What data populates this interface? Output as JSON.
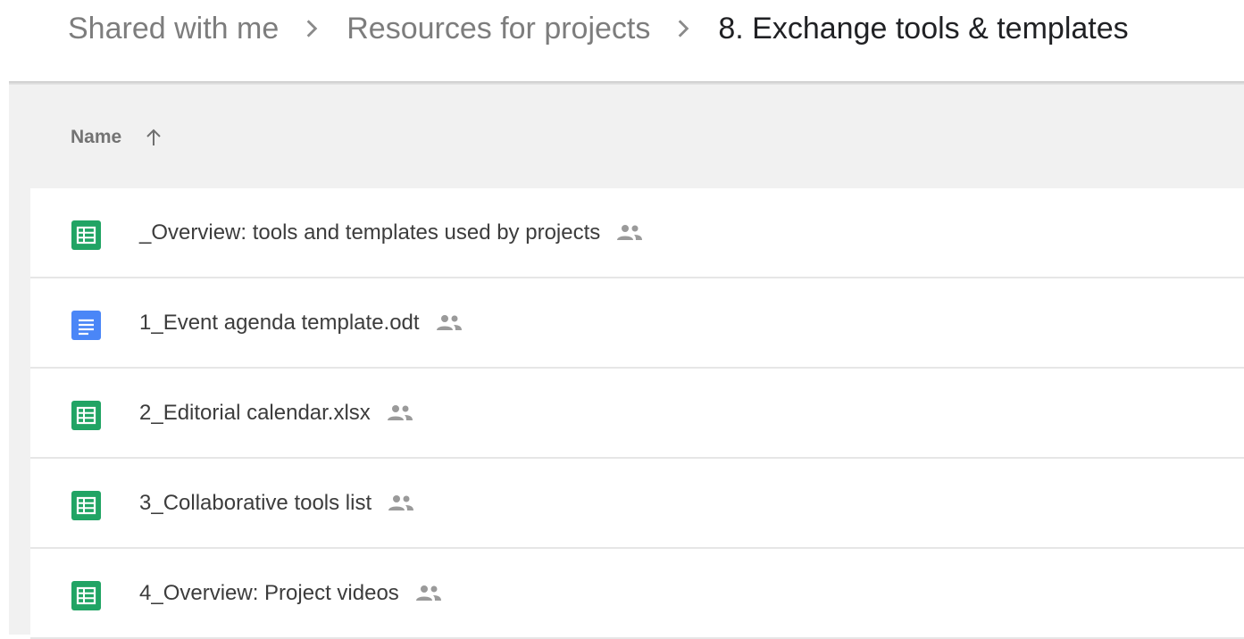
{
  "breadcrumb": {
    "items": [
      {
        "label": "Shared with me"
      },
      {
        "label": "Resources for projects"
      },
      {
        "label": "8. Exchange tools & templates"
      }
    ]
  },
  "list": {
    "column_name": "Name",
    "sort_direction": "ascending",
    "rows": [
      {
        "name": "_Overview: tools and templates used by projects",
        "type": "spreadsheet",
        "shared": true
      },
      {
        "name": "1_Event agenda template.odt",
        "type": "document",
        "shared": true
      },
      {
        "name": "2_Editorial calendar.xlsx",
        "type": "spreadsheet",
        "shared": true
      },
      {
        "name": "3_Collaborative tools list",
        "type": "spreadsheet",
        "shared": true
      },
      {
        "name": "4_Overview: Project videos",
        "type": "spreadsheet",
        "shared": true
      }
    ]
  },
  "icons": {
    "spreadsheet": "sheets-icon",
    "document": "docs-icon",
    "shared": "shared-people-icon",
    "separator": "chevron-right-icon",
    "sort": "arrow-up-icon"
  },
  "colors": {
    "sheets_green": "#21a464",
    "docs_blue": "#4a86f7",
    "row_background": "#ffffff",
    "list_background": "#f1f1f1"
  }
}
